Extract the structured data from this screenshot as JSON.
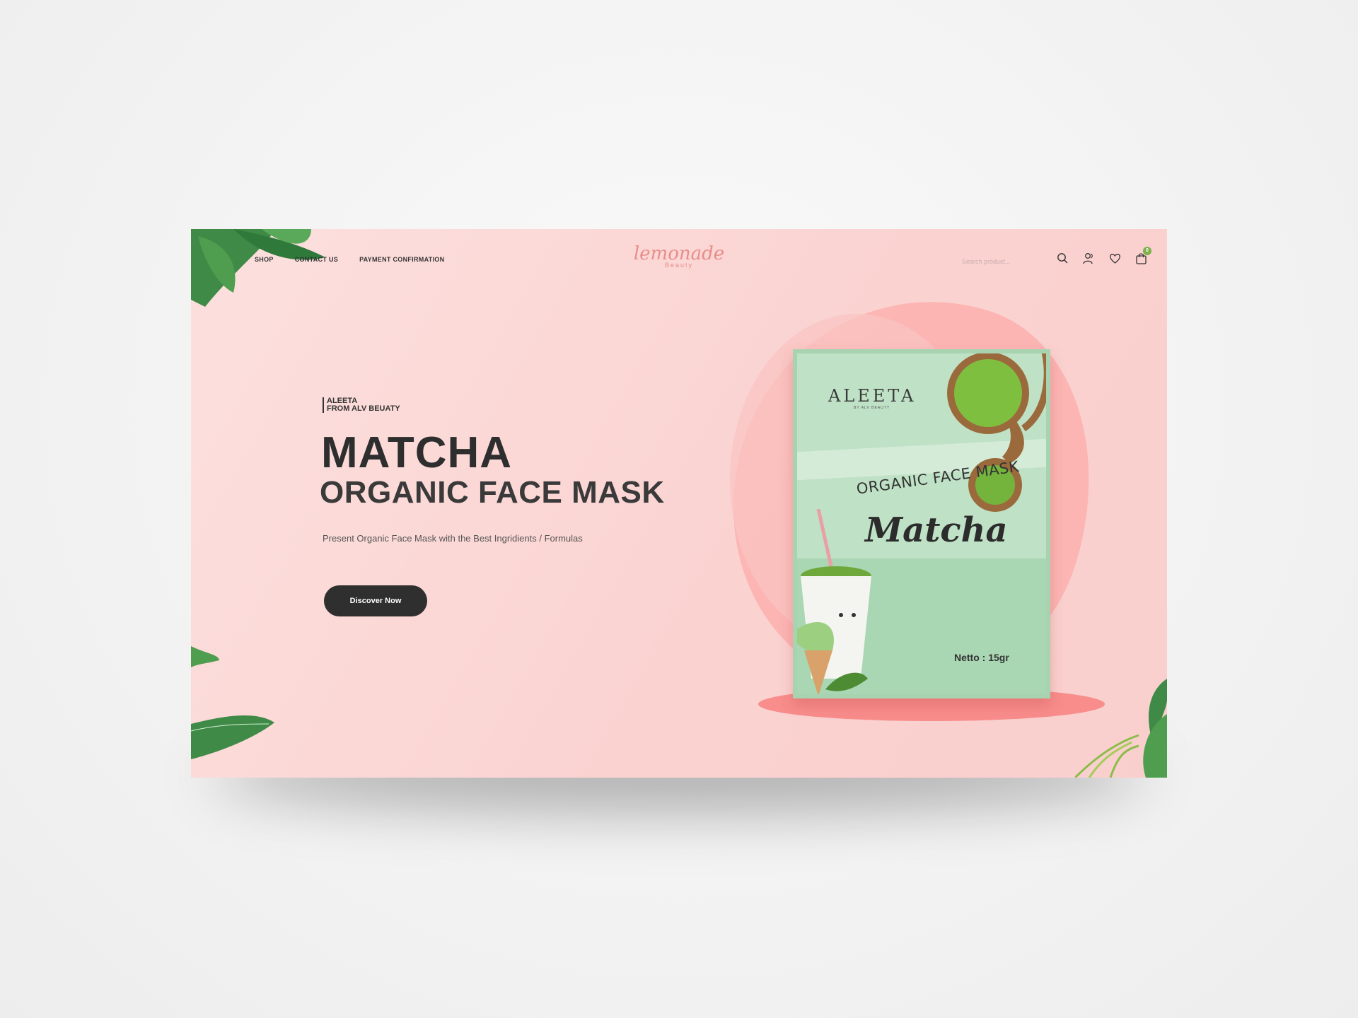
{
  "nav": {
    "links": [
      "SHOP",
      "CONTACT US",
      "PAYMENT CONFIRMATION"
    ]
  },
  "logo": {
    "main": "lemonade",
    "sub": "Beauty"
  },
  "search": {
    "placeholder": "Search product..."
  },
  "header_icons": [
    "search-icon",
    "user-icon",
    "heart-icon",
    "cart-icon"
  ],
  "cart": {
    "count": "0"
  },
  "hero": {
    "brand_line1": "ALEETA",
    "brand_line2": "FROM ALV BEUATY",
    "title": "MATCHA",
    "subtitle": "ORGANIC FACE MASK",
    "description": "Present Organic Face Mask with the Best Ingridients / Formulas",
    "cta_label": "Discover Now"
  },
  "product": {
    "brand": "ALEETA",
    "brand_sub": "BY ALV BEAUTY",
    "label": "ORGANIC FACE MASK",
    "name": "Matcha",
    "netto": "Netto : 15gr"
  },
  "colors": {
    "background": "#fad2d0",
    "accent": "#e88d8a",
    "button": "#2f2f2f",
    "badge": "#7bb04a",
    "pack": "#bfe1c6"
  }
}
